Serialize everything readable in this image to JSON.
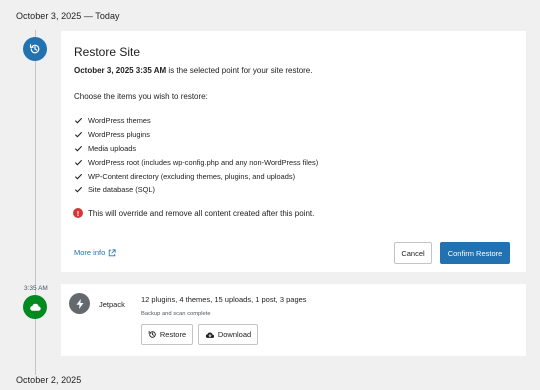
{
  "timeline": {
    "top_date": "October 3, 2025 — Today",
    "bottom_date": "October 2, 2025",
    "backup_time": "3:35 AM"
  },
  "restore": {
    "title": "Restore Site",
    "selected_point": "October 3, 2025 3:35 AM",
    "desc_suffix": " is the selected point for your site restore.",
    "choose_label": "Choose the items you wish to restore:",
    "items": [
      {
        "label": "WordPress themes",
        "checked": true
      },
      {
        "label": "WordPress plugins",
        "checked": true
      },
      {
        "label": "Media uploads",
        "checked": true
      },
      {
        "label": "WordPress root (includes wp-config.php and any non-WordPress files)",
        "checked": true
      },
      {
        "label": "WP-Content directory (excluding themes, plugins, and uploads)",
        "checked": true
      },
      {
        "label": "Site database (SQL)",
        "checked": true
      }
    ],
    "warning": "This will override and remove all content created after this point.",
    "more_info": "More info",
    "cancel_label": "Cancel",
    "confirm_label": "Confirm Restore"
  },
  "backup": {
    "source": "Jetpack",
    "summary": "12 plugins, 4 themes, 15 uploads, 1 post, 3 pages",
    "status": "Backup and scan complete",
    "restore_label": "Restore",
    "download_label": "Download"
  },
  "colors": {
    "accent": "#2271b1",
    "success": "#008a20",
    "error": "#d63638",
    "background": "#f0f0f1"
  },
  "icons": {
    "restore_node": "history-icon",
    "backup_node": "cloud-icon",
    "check": "checkmark-icon",
    "warning": "error-icon",
    "external": "external-link-icon",
    "jetpack": "jetpack-bolt-icon",
    "restore_button": "history-icon",
    "download_button": "cloud-download-icon"
  }
}
